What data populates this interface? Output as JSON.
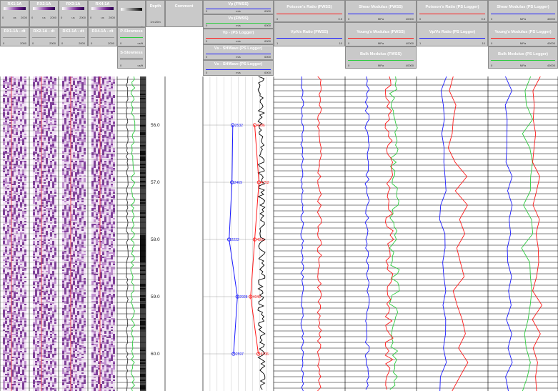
{
  "headers": {
    "tracks": [
      {
        "label": "RX1-1A",
        "unit": "us",
        "min": "0",
        "max": "2000"
      },
      {
        "label": "RX2-1A",
        "unit": "us",
        "min": "0",
        "max": "2000"
      },
      {
        "label": "RX3-1A",
        "unit": "us",
        "min": "0",
        "max": "2000"
      },
      {
        "label": "RX4-1A",
        "unit": "us",
        "min": "0",
        "max": "2000"
      }
    ],
    "dt_tracks": [
      {
        "label": "RX1-1A - dt",
        "min": "0",
        "max": "2000"
      },
      {
        "label": "RX2-1A - dt",
        "min": "0",
        "max": "2000"
      },
      {
        "label": "RX3-1A - dt",
        "min": "0",
        "max": "2000"
      },
      {
        "label": "RX4-1A - dt",
        "min": "0",
        "max": "2000"
      }
    ],
    "slowness": [
      {
        "label": "P-Slowness",
        "unit": "us/ft",
        "min": "0",
        "max": "1000"
      },
      {
        "label": "S-Slowness",
        "unit": "us/ft",
        "min": "0",
        "max": "1000"
      }
    ],
    "image_unit": "us/ft",
    "depth": {
      "label": "Depth",
      "unit": "1m:20m"
    },
    "comment": {
      "label": "Comment"
    },
    "velocity": [
      {
        "label": "Vp (FWSS)",
        "unit": "m/s",
        "min": "0",
        "max": "6000",
        "color": "#1a1aff"
      },
      {
        "label": "Vs (FWSS)",
        "unit": "m/s",
        "min": "0",
        "max": "6000",
        "color": "#2ecc40"
      },
      {
        "label": "Vp - (PS Logger)",
        "unit": "m/s",
        "min": "0",
        "max": "6000",
        "color": "#ff1a1a"
      },
      {
        "label": "Vs - SHWave (PS Logger)",
        "unit": "m/s",
        "min": "0",
        "max": "6000",
        "color": "#1a1aff"
      },
      {
        "label": "Vs - SHWave (PS Logger)",
        "unit": "m/s",
        "min": "0",
        "max": "6000",
        "color": "#1a1aff"
      }
    ],
    "fwss_ratio": [
      {
        "label": "Poisson's Ratio (FWSS)",
        "min": "0",
        "max": "0.5",
        "color": "#ff1a1a"
      },
      {
        "label": "Vp/Vs Ratio (FWSS)",
        "min": "1",
        "max": "10",
        "color": "#1a1aff"
      }
    ],
    "fwss_mod": [
      {
        "label": "Shear Modulus (FWSS)",
        "unit": "MPa",
        "min": "0",
        "max": "40000",
        "color": "#1a1aff"
      },
      {
        "label": "Young's Modulus (FWSS)",
        "unit": "MPa",
        "min": "0",
        "max": "40000",
        "color": "#ff1a1a"
      },
      {
        "label": "Bulk Modulus (FWSS)",
        "unit": "MPa",
        "min": "0",
        "max": "40000",
        "color": "#2ecc40"
      }
    ],
    "ps_ratio": [
      {
        "label": "Poisson's Ratio (PS Logger)",
        "min": "0",
        "max": "0.5",
        "color": "#ff1a1a"
      },
      {
        "label": "Vp/Vs Ratio (PS Logger)",
        "min": "1",
        "max": "10",
        "color": "#1a1aff"
      }
    ],
    "ps_mod": [
      {
        "label": "Shear Modulus (PS Logger)",
        "unit": "MPa",
        "min": "0",
        "max": "40000",
        "color": "#1a1aff"
      },
      {
        "label": "Young's Modulus (PS Logger)",
        "unit": "MPa",
        "min": "0",
        "max": "40000",
        "color": "#ff1a1a"
      },
      {
        "label": "Bulk Modulus (PS Logger)",
        "unit": "MPa",
        "min": "0",
        "max": "40000",
        "color": "#2ecc40"
      }
    ]
  },
  "depth_ticks": [
    "56.0",
    "57.0",
    "58.0",
    "59.0",
    "60.0"
  ],
  "depth_values": [
    56.0,
    57.0,
    58.0,
    59.0,
    60.0
  ],
  "depth_range": [
    55.15,
    60.65
  ],
  "vs_points": [
    {
      "depth": 56.0,
      "value": 2532
    },
    {
      "depth": 57.0,
      "value": 2469
    },
    {
      "depth": 58.0,
      "value": 2222
    },
    {
      "depth": 59.0,
      "value": 2928
    },
    {
      "depth": 60.0,
      "value": 2597
    }
  ],
  "vp_points": [
    {
      "depth": 56.0,
      "value": 4396
    },
    {
      "depth": 57.0,
      "value": 4752
    },
    {
      "depth": 58.0,
      "value": 4391
    },
    {
      "depth": 59.0,
      "value": 4046
    },
    {
      "depth": 60.0,
      "value": 4706
    }
  ],
  "vs_label": [
    "2532",
    "2469",
    "2222",
    "2928",
    "2597"
  ],
  "vp_label": [
    "4396",
    "4752",
    "4391",
    "4046",
    "4706"
  ],
  "colors": {
    "header_bg": "#c9c9c9",
    "blue": "#1a1aff",
    "red": "#ff1a1a",
    "green": "#2ecc40",
    "purple": "#6a1e88"
  }
}
